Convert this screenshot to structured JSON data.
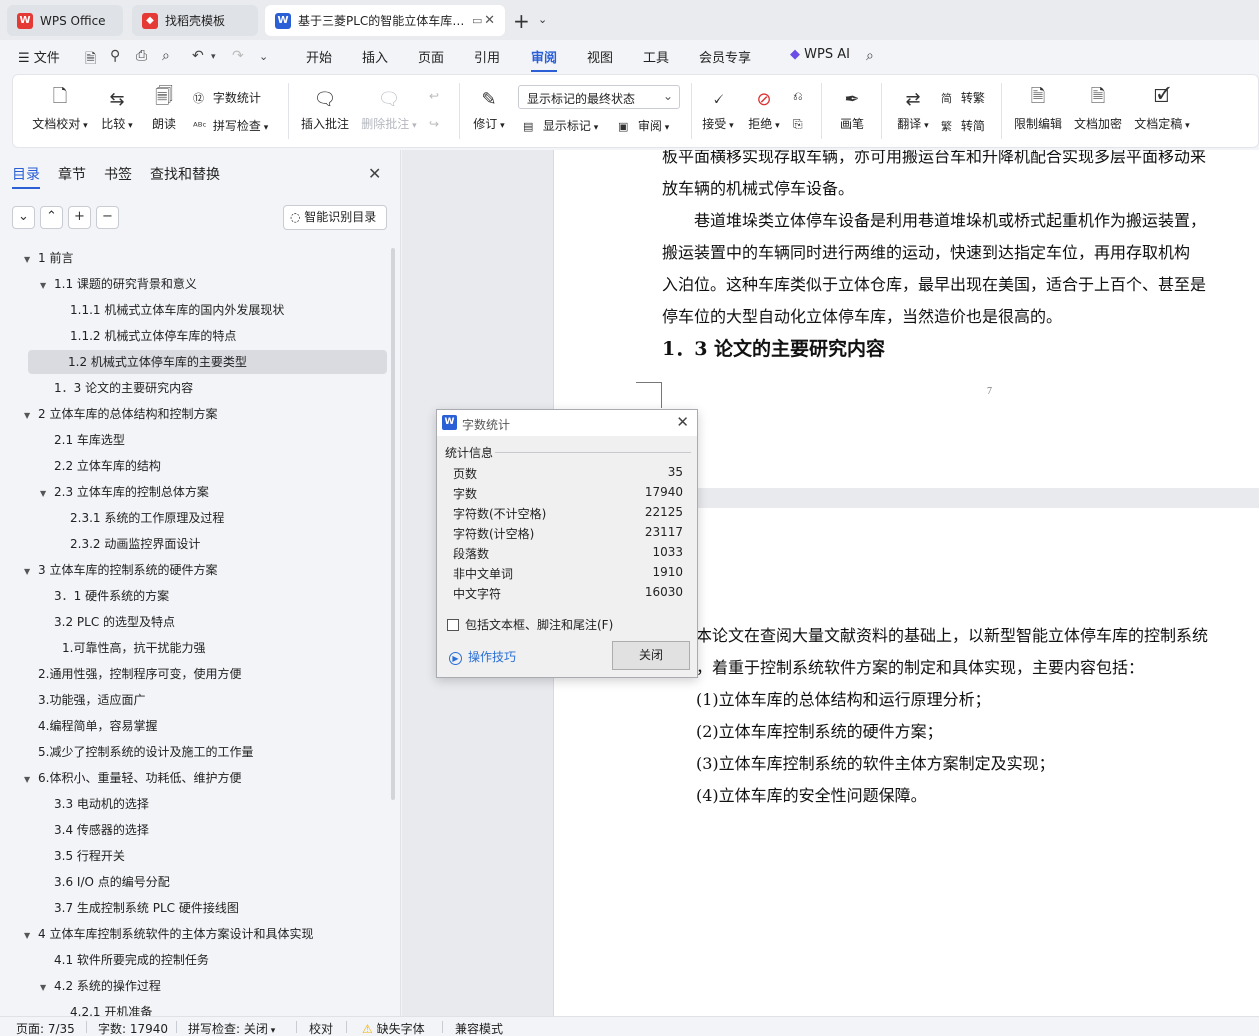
{
  "tabs": [
    {
      "label": "WPS Office",
      "icon": "wps-logo-icon",
      "color": "#e53935"
    },
    {
      "label": "找稻壳模板",
      "icon": "docer-icon",
      "color": "#e53935"
    },
    {
      "label": "基于三菱PLC的智能立体车库控制系统设计",
      "icon": "wps-writer-icon",
      "color": "#2a5fd6"
    }
  ],
  "menu": {
    "file": "文件",
    "items": [
      "开始",
      "插入",
      "页面",
      "引用",
      "审阅",
      "视图",
      "工具",
      "会员专享"
    ],
    "active": "审阅",
    "ai": "WPS AI"
  },
  "ribbon": {
    "proofread": "文档校对",
    "compare": "比较",
    "read_aloud": "朗读",
    "word_count": "字数统计",
    "spell_check": "拼写检查",
    "insert_comment": "插入批注",
    "delete_comment": "删除批注",
    "track": "修订",
    "show_markup_combo": "显示标记的最终状态",
    "show_markup": "显示标记",
    "review": "审阅",
    "accept": "接受",
    "reject": "拒绝",
    "pen": "画笔",
    "translate": "翻译",
    "to_traditional": "转繁",
    "to_simplified": "转简",
    "restrict": "限制编辑",
    "encrypt": "文档加密",
    "finalize": "文档定稿"
  },
  "sidebar": {
    "tabs": [
      "目录",
      "章节",
      "书签",
      "查找和替换"
    ],
    "active_tab": "目录",
    "smart_btn": "智能识别目录",
    "toc": [
      {
        "text": "1   前言",
        "level": 0,
        "arrow": "▼"
      },
      {
        "text": "1.1   课题的研究背景和意义",
        "level": 1,
        "arrow": "▼"
      },
      {
        "text": "1.1.1   机械式立体车库的国内外发展现状",
        "level": 2,
        "arrow": ""
      },
      {
        "text": "1.1.2   机械式立体停车库的特点",
        "level": 2,
        "arrow": ""
      },
      {
        "text": "1.2   机械式立体停车库的主要类型",
        "level": 1,
        "arrow": "",
        "selected": true
      },
      {
        "text": "1．3   论文的主要研究内容",
        "level": 1,
        "arrow": ""
      },
      {
        "text": "2   立体车库的总体结构和控制方案",
        "level": 0,
        "arrow": "▼"
      },
      {
        "text": "2.1   车库选型",
        "level": 1,
        "arrow": ""
      },
      {
        "text": "2.2   立体车库的结构",
        "level": 1,
        "arrow": ""
      },
      {
        "text": "2.3   立体车库的控制总体方案",
        "level": 1,
        "arrow": "▼"
      },
      {
        "text": "2.3.1   系统的工作原理及过程",
        "level": 2,
        "arrow": ""
      },
      {
        "text": "2.3.2   动画监控界面设计",
        "level": 2,
        "arrow": ""
      },
      {
        "text": "3   立体车库的控制系统的硬件方案",
        "level": 0,
        "arrow": "▼"
      },
      {
        "text": "3．1   硬件系统的方案",
        "level": 1,
        "arrow": ""
      },
      {
        "text": "3.2   PLC 的选型及特点",
        "level": 1,
        "arrow": ""
      },
      {
        "text": "1.可靠性高，抗干扰能力强",
        "level": 1.5,
        "arrow": ""
      },
      {
        "text": "2.通用性强，控制程序可变，使用方便",
        "level": 0.5,
        "arrow": ""
      },
      {
        "text": "3.功能强，适应面广",
        "level": 0.5,
        "arrow": ""
      },
      {
        "text": "4.编程简单，容易掌握",
        "level": 0.5,
        "arrow": ""
      },
      {
        "text": "5.减少了控制系统的设计及施工的工作量",
        "level": 0.5,
        "arrow": ""
      },
      {
        "text": "6.体积小、重量轻、功耗低、维护方便",
        "level": 0.5,
        "arrow": "▼"
      },
      {
        "text": "3.3   电动机的选择",
        "level": 1,
        "arrow": ""
      },
      {
        "text": "3.4   传感器的选择",
        "level": 1,
        "arrow": ""
      },
      {
        "text": "3.5   行程开关",
        "level": 1,
        "arrow": ""
      },
      {
        "text": "3.6   I/O 点的编号分配",
        "level": 1,
        "arrow": ""
      },
      {
        "text": "3.7   生成控制系统 PLC 硬件接线图",
        "level": 1,
        "arrow": ""
      },
      {
        "text": "4   立体车库控制系统软件的主体方案设计和具体实现",
        "level": 0,
        "arrow": "▼"
      },
      {
        "text": "4.1   软件所要完成的控制任务",
        "level": 1,
        "arrow": ""
      },
      {
        "text": "4.2   系统的操作过程",
        "level": 1,
        "arrow": "▼"
      },
      {
        "text": "4.2.1   开机准备",
        "level": 2,
        "arrow": ""
      }
    ]
  },
  "document": {
    "page1_lines": [
      "板平面横移实现存取车辆，亦可用搬运台车和升降机配合实现多层平面移动来",
      "放车辆的机械式停车设备。",
      "巷道堆垛类立体停车设备是利用巷道堆垛机或桥式起重机作为搬运装置，",
      "搬运装置中的车辆同时进行两维的运动，快速到达指定车位，再用存取机构",
      "入泊位。这种车库类似于立体仓库，最早出现在美国，适合于上百个、甚至是",
      "停车位的大型自动化立体停车库，当然造价也是很高的。"
    ],
    "page1_heading": "1．3   论文的主要研究内容",
    "page_number": "7",
    "page2_lines": [
      "本论文在查阅大量文献资料的基础上，以新型智能立体停车库的控制系统",
      "，着重于控制系统软件方案的制定和具体实现，主要内容包括：",
      "(1)立体车库的总体结构和运行原理分析；",
      "(2)立体车库控制系统的硬件方案；",
      "(3)立体车库控制系统的软件主体方案制定及实现；",
      "(4)立体车库的安全性问题保障。"
    ]
  },
  "dialog": {
    "title": "字数统计",
    "group": "统计信息",
    "stats": [
      {
        "label": "页数",
        "value": "35"
      },
      {
        "label": "字数",
        "value": "17940"
      },
      {
        "label": "字符数(不计空格)",
        "value": "22125"
      },
      {
        "label": "字符数(计空格)",
        "value": "23117"
      },
      {
        "label": "段落数",
        "value": "1033"
      },
      {
        "label": "非中文单词",
        "value": "1910"
      },
      {
        "label": "中文字符",
        "value": "16030"
      }
    ],
    "checkbox": "包括文本框、脚注和尾注(F)",
    "tips": "操作技巧",
    "close": "关闭"
  },
  "status": {
    "page": "页面: 7/35",
    "words": "字数: 17940",
    "spell": "拼写检查: 关闭",
    "proof": "校对",
    "missing_font": "缺失字体",
    "compat": "兼容模式"
  },
  "colors": {
    "accent": "#2a5fd6",
    "selected_row": "#d9dbe0",
    "warning": "#f0b400"
  }
}
